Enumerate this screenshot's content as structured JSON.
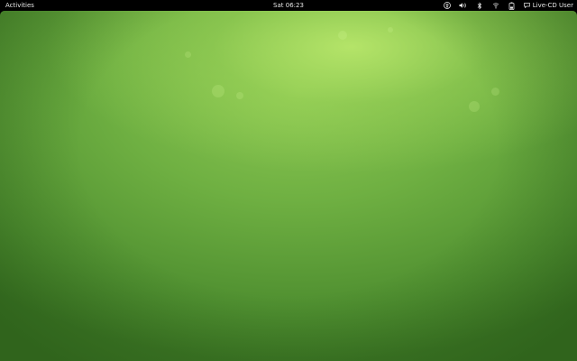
{
  "topbar": {
    "activities_label": "Activities",
    "clock": "Sat 06:23",
    "user_label": "Live-CD User",
    "icons": [
      "accessibility-icon",
      "volume-icon",
      "bluetooth-icon",
      "wifi-icon",
      "battery-icon",
      "chat-icon"
    ]
  },
  "desktop": {
    "wallpaper_colors": {
      "highlight": "#c4ea6e",
      "mid": "#6fb042",
      "dark": "#3f7a26"
    }
  }
}
